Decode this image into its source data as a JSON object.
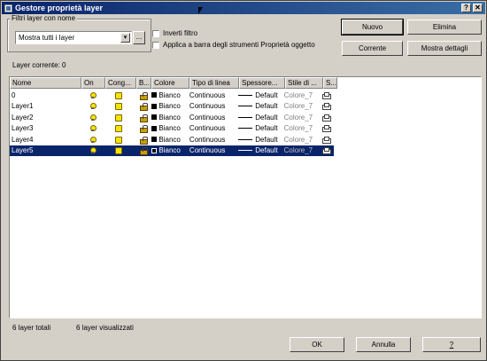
{
  "window": {
    "title": "Gestore proprietà layer",
    "help_btn": "?",
    "close_btn": "✕"
  },
  "filter": {
    "group_label": "Filtri layer con nome",
    "combo_value": "Mostra tutti i layer",
    "ellipsis": "...",
    "invert_label": "Inverti filtro",
    "apply_label": "Applica a barra degli strumenti Proprietà oggetto"
  },
  "buttons": {
    "new": "Nuovo",
    "delete": "Elimina",
    "current": "Corrente",
    "details": "Mostra dettagli",
    "ok": "OK",
    "cancel": "Annulla",
    "help": "?"
  },
  "current_layer": "Layer corrente: 0",
  "columns": [
    "Nome",
    "On",
    "Cong...",
    "B...",
    "Colore",
    "Tipo di linea",
    "Spessore...",
    "Stile di ...",
    "S..."
  ],
  "rows": [
    {
      "name": "0",
      "color": "Bianco",
      "linetype": "Continuous",
      "lineweight": "Default",
      "plotstyle": "Colore_7",
      "selected": false
    },
    {
      "name": "Layer1",
      "color": "Bianco",
      "linetype": "Continuous",
      "lineweight": "Default",
      "plotstyle": "Colore_7",
      "selected": false
    },
    {
      "name": "Layer2",
      "color": "Bianco",
      "linetype": "Continuous",
      "lineweight": "Default",
      "plotstyle": "Colore_7",
      "selected": false
    },
    {
      "name": "Layer3",
      "color": "Bianco",
      "linetype": "Continuous",
      "lineweight": "Default",
      "plotstyle": "Colore_7",
      "selected": false
    },
    {
      "name": "Layer4",
      "color": "Bianco",
      "linetype": "Continuous",
      "lineweight": "Default",
      "plotstyle": "Colore_7",
      "selected": false
    },
    {
      "name": "Layer5",
      "color": "Bianco",
      "linetype": "Continuous",
      "lineweight": "Default",
      "plotstyle": "Colore_7",
      "selected": true
    }
  ],
  "status": {
    "total": "6 layer totali",
    "shown": "6 layer visualizzati"
  },
  "colors": {
    "titlebar": "#0a246a",
    "selection": "#0a246a",
    "face": "#d4d0c8"
  }
}
